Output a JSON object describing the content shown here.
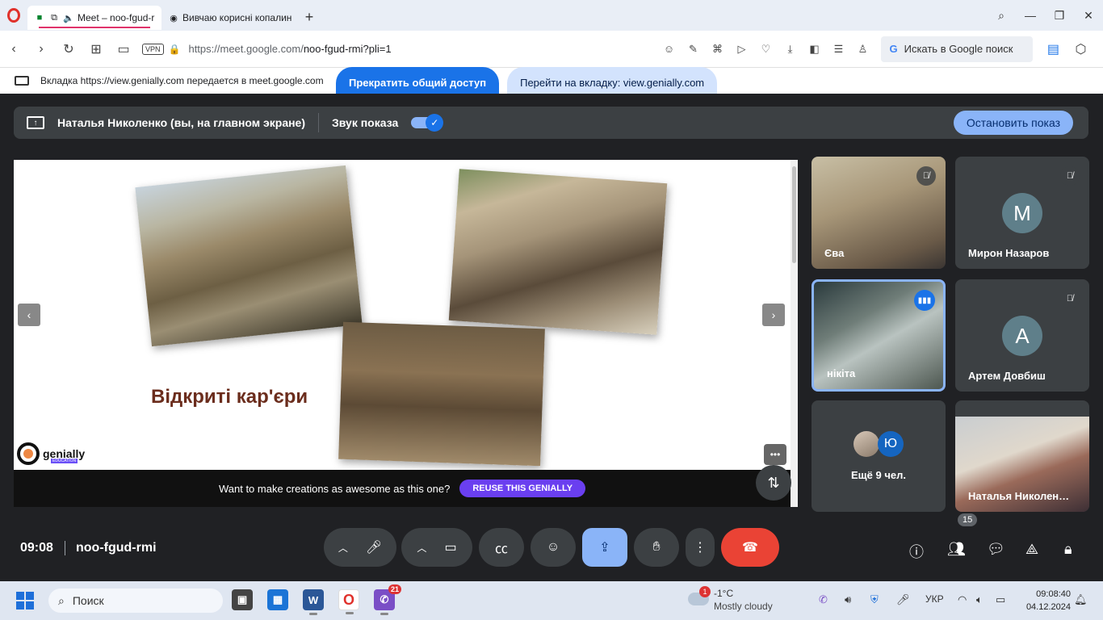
{
  "browser": {
    "tabs": [
      {
        "title": "Meet – noo-fgud-r",
        "active": true
      },
      {
        "title": "Вивчаю корисні копалин",
        "active": false
      }
    ],
    "url_host": "https://meet.google.com/",
    "url_path": "noo-fgud-rmi?pli=1",
    "vpn_label": "VPN",
    "search_placeholder": "Искать в Google поиск"
  },
  "share_notice": {
    "message": "Вкладка https://view.genially.com передается в meet.google.com",
    "stop_label": "Прекратить общий доступ",
    "goto_label": "Перейти на вкладку: view.genially.com"
  },
  "presenting": {
    "who": "Наталья Николенко (вы, на главном экране)",
    "sound_label": "Звук показа",
    "sound_on": true,
    "stop_label": "Остановить показ"
  },
  "slide": {
    "title": "Відкриті кар'єри",
    "brand": "genially",
    "brand_sub": "EDUCATION",
    "promo_text": "Want to make creations as awesome as this one?",
    "promo_button": "REUSE THIS GENIALLY"
  },
  "participants": [
    {
      "name": "Єва",
      "muted": true,
      "video": true
    },
    {
      "name": "Мирон Назаров",
      "initial": "М",
      "muted": true,
      "video": false
    },
    {
      "name": "нікіта",
      "speaking": true,
      "video": true
    },
    {
      "name": "Артем Довбиш",
      "initial": "А",
      "muted": true,
      "video": false
    },
    {
      "name": "Ещё 9 чел.",
      "avatar_letter": "Ю"
    },
    {
      "name": "Наталья Николен…",
      "video": true
    }
  ],
  "meeting": {
    "time": "09:08",
    "code": "noo-fgud-rmi",
    "participant_count": "15"
  },
  "taskbar": {
    "search_label": "Поиск",
    "viber_badge": "21",
    "weather_badge": "1",
    "temperature": "-1°C",
    "weather_desc": "Mostly cloudy",
    "language": "УКР",
    "clock_time": "09:08:40",
    "clock_date": "04.12.2024"
  },
  "colors": {
    "meet_bg": "#202124",
    "accent_blue": "#1a73e8",
    "end_call_red": "#ea4335",
    "genially_purple": "#6a3ff0"
  }
}
